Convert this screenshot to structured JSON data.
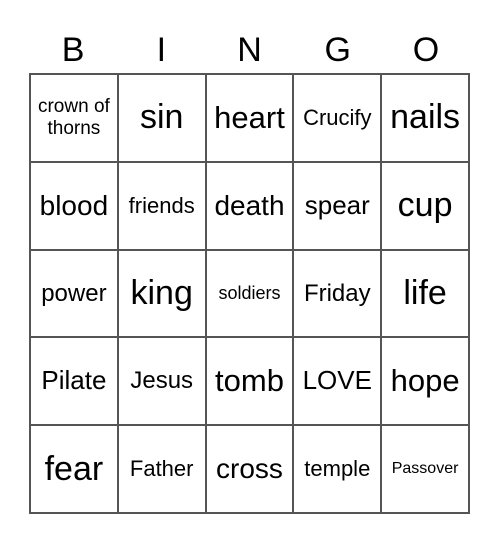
{
  "header": [
    "B",
    "I",
    "N",
    "G",
    "O"
  ],
  "cells": [
    "crown of thorns",
    "sin",
    "heart",
    "Crucify",
    "nails",
    "blood",
    "friends",
    "death",
    "spear",
    "cup",
    "power",
    "king",
    "soldiers",
    "Friday",
    "life",
    "Pilate",
    "Jesus",
    "tomb",
    "LOVE",
    "hope",
    "fear",
    "Father",
    "cross",
    "temple",
    "Passover"
  ]
}
